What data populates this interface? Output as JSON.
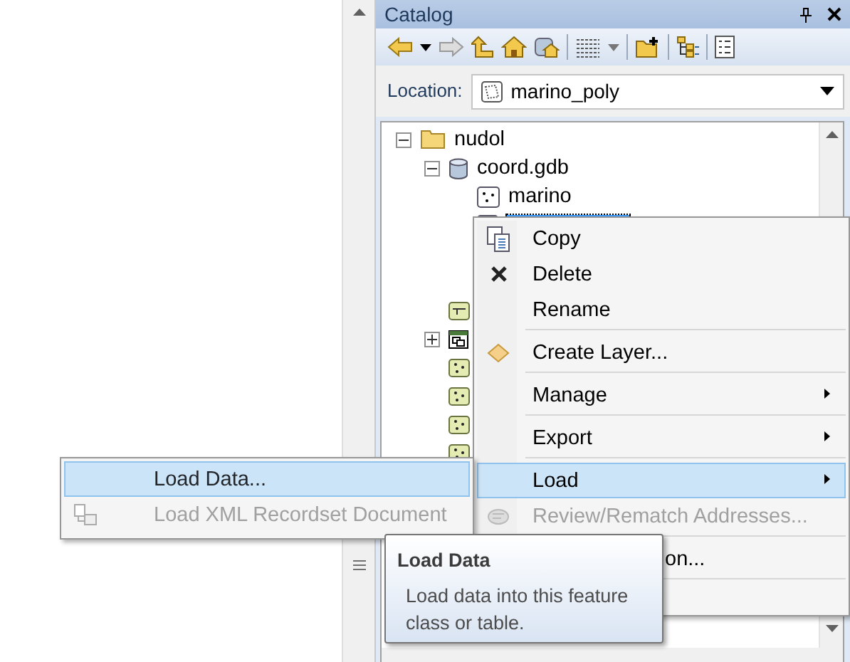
{
  "panel": {
    "title": "Catalog"
  },
  "location": {
    "label": "Location:",
    "value": "marino_poly"
  },
  "tree": [
    {
      "label": "nudol",
      "kind": "folder",
      "expanded": true,
      "children": [
        {
          "label": "coord.gdb",
          "kind": "database",
          "expanded": true,
          "children": [
            {
              "label": "marino",
              "kind": "point-class",
              "selected": false
            },
            {
              "kind": "polygon-class",
              "selected": true
            }
          ]
        },
        {
          "kind": "relationship"
        },
        {
          "kind": "raster-catalog",
          "expanded": false
        },
        {
          "kind": "point-class-green"
        },
        {
          "kind": "point-class-green"
        },
        {
          "kind": "point-class-green"
        },
        {
          "kind": "point-class-green"
        }
      ]
    }
  ],
  "context_menu": [
    {
      "kind": "copy",
      "label": "Copy",
      "disabled": false,
      "selected": false,
      "submenu": false
    },
    {
      "kind": "delete",
      "label": "Delete",
      "disabled": false,
      "selected": false,
      "submenu": false
    },
    {
      "kind": "plain",
      "label": "Rename",
      "disabled": false,
      "selected": false,
      "submenu": false
    },
    {
      "kind": "separator"
    },
    {
      "kind": "create-layer",
      "label": "Create Layer...",
      "disabled": false,
      "selected": false,
      "submenu": false
    },
    {
      "kind": "separator"
    },
    {
      "kind": "plain",
      "label": "Manage",
      "disabled": false,
      "selected": false,
      "submenu": true
    },
    {
      "kind": "separator"
    },
    {
      "kind": "plain",
      "label": "Export",
      "disabled": false,
      "selected": false,
      "submenu": true
    },
    {
      "kind": "separator"
    },
    {
      "kind": "plain",
      "label": "Load",
      "disabled": false,
      "selected": true,
      "submenu": true
    },
    {
      "kind": "review",
      "label": "Review/Rematch Addresses...",
      "disabled": true,
      "selected": false,
      "submenu": false
    },
    {
      "kind": "separator"
    },
    {
      "kind": "covered",
      "label": "on...",
      "disabled": false,
      "selected": false,
      "submenu": false
    },
    {
      "kind": "separator"
    }
  ],
  "submenu": [
    {
      "kind": "plain",
      "label": "Load Data...",
      "disabled": false,
      "selected": true
    },
    {
      "kind": "xml",
      "label": "Load XML Recordset Document",
      "disabled": true,
      "selected": false
    }
  ],
  "tooltip": {
    "title": "Load Data",
    "text": "Load data into this feature class or table."
  }
}
